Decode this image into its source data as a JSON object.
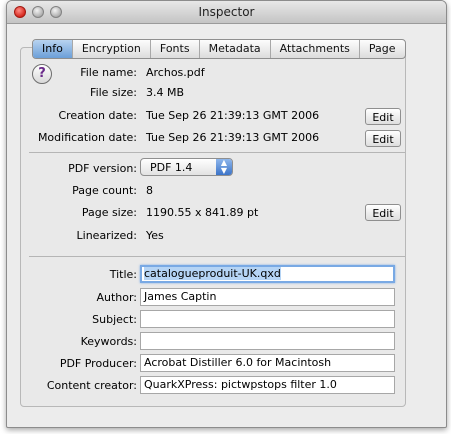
{
  "window": {
    "title": "Inspector"
  },
  "tabs": [
    "Info",
    "Encryption",
    "Fonts",
    "Metadata",
    "Attachments",
    "Page"
  ],
  "file": {
    "name_label": "File name:",
    "name": "Archos.pdf",
    "size_label": "File size:",
    "size": "3.4 MB",
    "creation_label": "Creation date:",
    "creation": "Tue Sep 26 21:39:13 GMT 2006",
    "modification_label": "Modification date:",
    "modification": "Tue Sep 26 21:39:13 GMT 2006",
    "edit_label": "Edit"
  },
  "pdf": {
    "version_label": "PDF version:",
    "version": "PDF 1.4",
    "page_count_label": "Page count:",
    "page_count": "8",
    "page_size_label": "Page size:",
    "page_size": "1190.55 x 841.89 pt",
    "linearized_label": "Linearized:",
    "linearized": "Yes"
  },
  "meta": {
    "title_label": "Title:",
    "title": "catalogueproduit-UK.qxd",
    "author_label": "Author:",
    "author": "James Captin",
    "subject_label": "Subject:",
    "subject": "",
    "keywords_label": "Keywords:",
    "keywords": "",
    "producer_label": "PDF Producer:",
    "producer": "Acrobat Distiller 6.0 for Macintosh",
    "creator_label": "Content creator:",
    "creator": "QuarkXPress: pictwpstops filter 1.0"
  },
  "icons": {
    "help": "help-icon"
  }
}
